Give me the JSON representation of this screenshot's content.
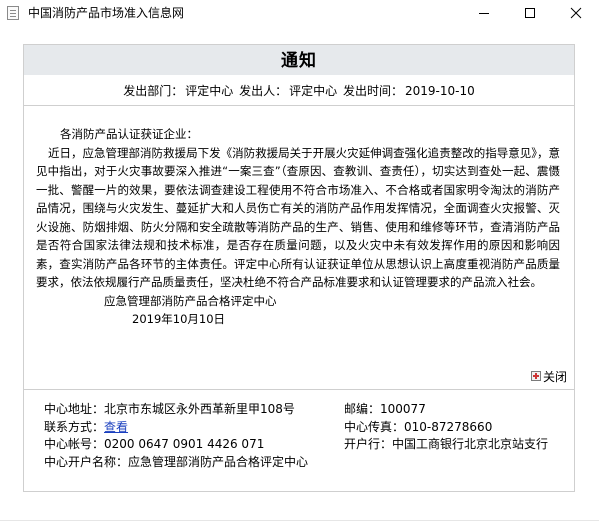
{
  "window": {
    "title": "中国消防产品市场准入信息网",
    "icon": "document-icon",
    "controls": [
      "minimize-icon",
      "maximize-icon",
      "close-icon"
    ]
  },
  "notice": {
    "heading": "通知",
    "meta": {
      "dept_label": "发出部门：",
      "dept": "评定中心",
      "sender_label": "发出人：",
      "sender": "评定中心",
      "time_label": "发出时间：",
      "time": "2019-10-10"
    },
    "body": {
      "salutation": "各消防产品认证获证企业：",
      "paragraph": "近日，应急管理部消防救援局下发《消防救援局关于开展火灾延伸调查强化追责整改的指导意见》，意见中指出，对于火灾事故要深入推进“一案三查”（查原因、查教训、查责任），切实达到查处一起、震慑一批、警醒一片的效果，要依法调查建设工程使用不符合市场准入、不合格或者国家明令淘汰的消防产品情况，围绕与火灾发生、蔓延扩大和人员伤亡有关的消防产品作用发挥情况，全面调查火灾报警、灭火设施、防烟排烟、防火分隔和安全疏散等消防产品的生产、销售、使用和维修等环节，查清消防产品是否符合国家法律法规和技术标准，是否存在质量问题，以及火灾中未有效发挥作用的原因和影响因素，查实消防产品各环节的主体责任。评定中心所有认证获证单位从思想认识上高度重视消防产品质量要求，依法依规履行产品质量责任，坚决杜绝不符合产品标准要求和认证管理要求的产品流入社会。",
      "signature": "应急管理部消防产品合格评定中心",
      "date": "2019年10月10日"
    },
    "close_label": "关闭",
    "close_icon": "close-box-icon"
  },
  "footer": {
    "address_label": "中心地址：",
    "address": "北京市东城区永外西革新里甲108号",
    "postcode_label": "邮编：",
    "postcode": "100077",
    "contact_label": "联系方式：",
    "contact_link": "查看",
    "fax_label": "中心传真：",
    "fax": "010-87278660",
    "account_label": "中心帐号：",
    "account": "0200 0647 0901 4426 071",
    "bank_label": "开户行：",
    "bank": "中国工商银行北京北京站支行",
    "account_name_label": "中心开户名称：",
    "account_name": "应急管理部消防产品合格评定中心"
  },
  "colors": {
    "header_bg": "#e6e9ec",
    "border": "#cfcfcf",
    "link": "#1a3fbf"
  }
}
